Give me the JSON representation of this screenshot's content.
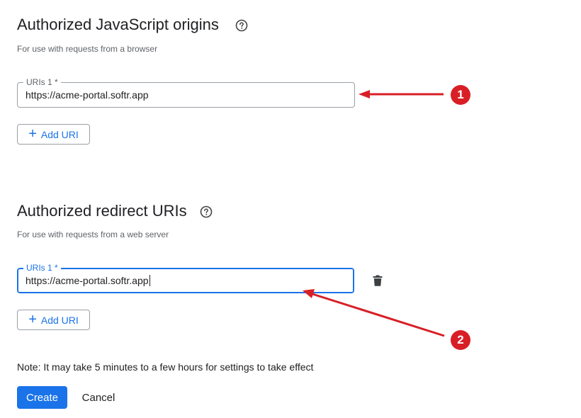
{
  "origins_section": {
    "title": "Authorized JavaScript origins",
    "subtitle": "For use with requests from a browser",
    "field_label": "URIs 1 *",
    "field_value": "https://acme-portal.softr.app",
    "add_label": "Add URI",
    "help_icon": "help-circle-icon"
  },
  "redirect_section": {
    "title": "Authorized redirect URIs",
    "subtitle": "For use with requests from a web server",
    "field_label": "URIs 1 *",
    "field_value": "https://acme-portal.softr.app",
    "add_label": "Add URI",
    "help_icon": "help-circle-icon",
    "delete_icon": "trash-icon"
  },
  "note": "Note: It may take 5 minutes to a few hours for settings to take effect",
  "actions": {
    "create_label": "Create",
    "cancel_label": "Cancel"
  },
  "annotations": [
    {
      "label": "1",
      "color": "#d81f26"
    },
    {
      "label": "2",
      "color": "#d81f26"
    }
  ],
  "colors": {
    "accent": "#1a73e8",
    "annotation": "#d81f26",
    "border": "#9aa0a6",
    "subtle_text": "#5f6368"
  }
}
